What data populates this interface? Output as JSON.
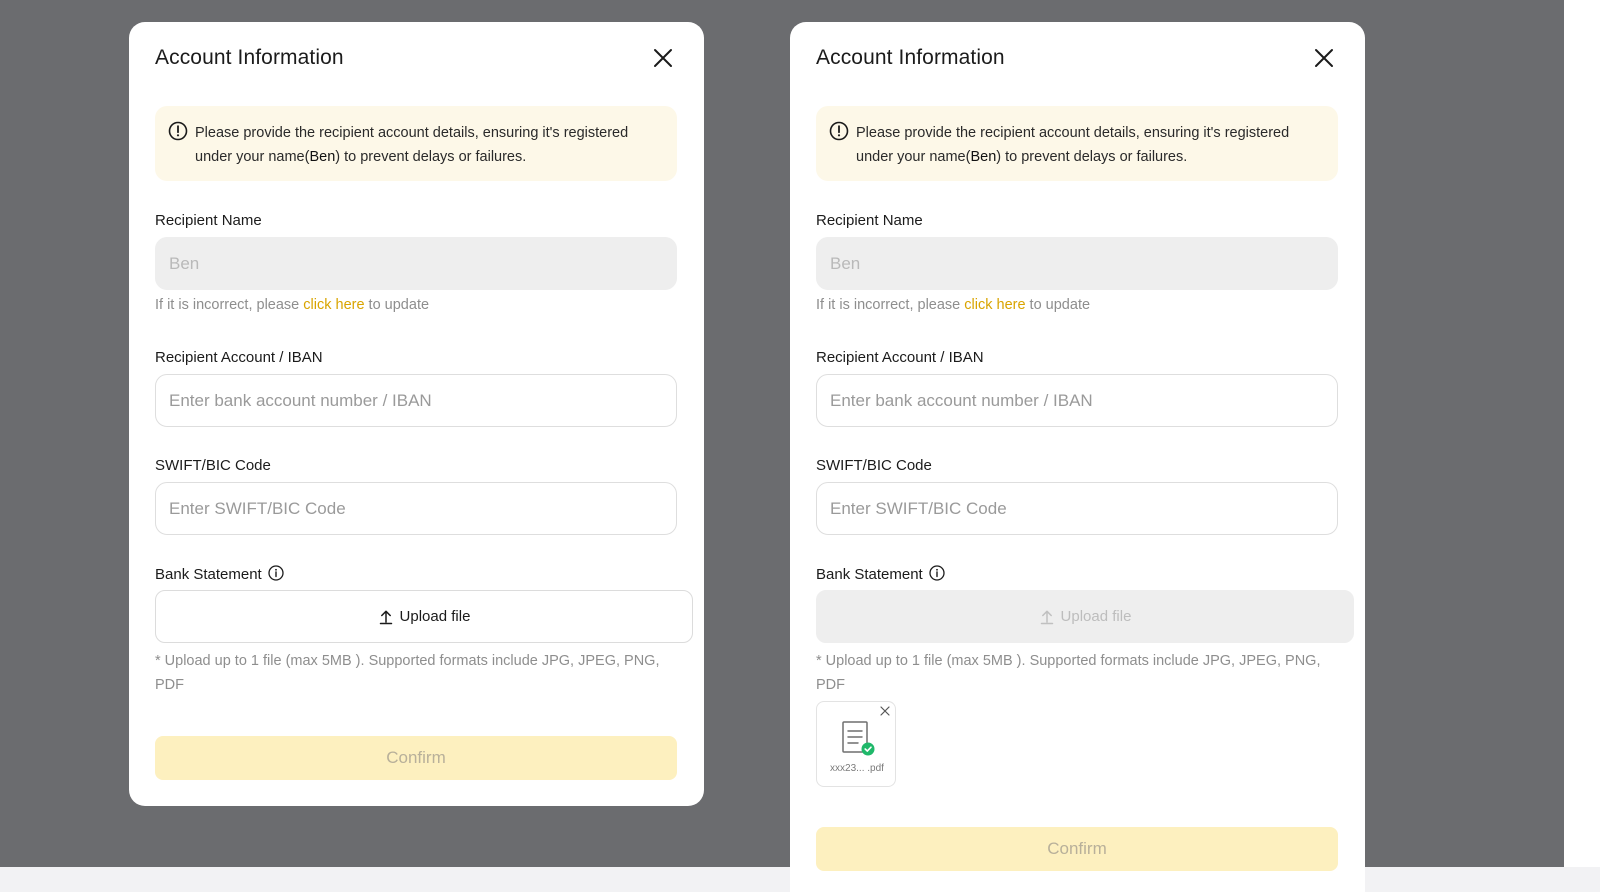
{
  "modals": [
    {
      "title": "Account Information",
      "notice": {
        "text_before": "Please provide the recipient account details, ensuring it's registered under your name(",
        "name": "Ben",
        "text_after": ") to prevent delays or failures."
      },
      "recipient_name": {
        "label": "Recipient Name",
        "value": "Ben",
        "helper_before": "If it is incorrect, please ",
        "helper_link": "click here",
        "helper_after": " to update"
      },
      "account": {
        "label": "Recipient Account / IBAN",
        "placeholder": "Enter bank account number / IBAN"
      },
      "swift": {
        "label": "SWIFT/BIC Code",
        "placeholder": "Enter SWIFT/BIC Code"
      },
      "statement": {
        "label": "Bank Statement",
        "upload_label": "Upload file",
        "note": "* Upload up to 1 file (max 5MB ). Supported formats include JPG, JPEG, PNG, PDF"
      },
      "confirm_label": "Confirm"
    },
    {
      "title": "Account Information",
      "notice": {
        "text_before": "Please provide the recipient account details, ensuring it's registered under your name(",
        "name": "Ben",
        "text_after": ") to prevent delays or failures."
      },
      "recipient_name": {
        "label": "Recipient Name",
        "value": "Ben",
        "helper_before": "If it is incorrect, please ",
        "helper_link": "click here",
        "helper_after": " to update"
      },
      "account": {
        "label": "Recipient Account / IBAN",
        "placeholder": "Enter bank account number / IBAN"
      },
      "swift": {
        "label": "SWIFT/BIC Code",
        "placeholder": "Enter SWIFT/BIC Code"
      },
      "statement": {
        "label": "Bank Statement",
        "upload_label": "Upload file",
        "note": "* Upload up to 1 file (max 5MB ). Supported formats include JPG, JPEG, PNG, PDF",
        "uploaded_file": "xxx23... .pdf"
      },
      "confirm_label": "Confirm"
    }
  ],
  "colors": {
    "backdrop": "#6b6c6f",
    "accent_link": "#d9a400",
    "notice_bg": "#fdf8e8",
    "confirm_disabled_bg": "#fdf0bf",
    "success_green": "#1fb86a"
  },
  "icons": [
    "close-icon",
    "info-circle-icon",
    "upload-icon",
    "document-icon",
    "check-badge-icon"
  ]
}
